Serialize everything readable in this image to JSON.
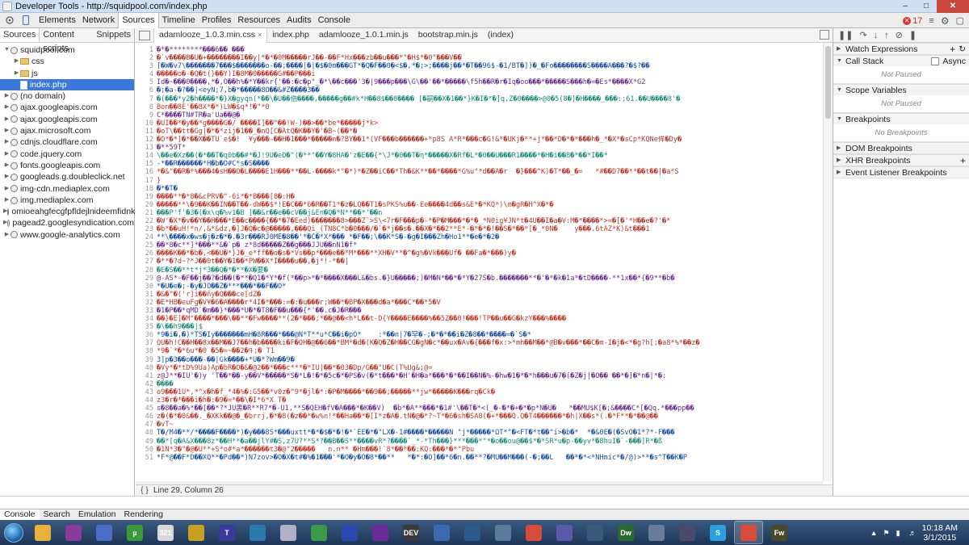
{
  "window": {
    "title": "Developer Tools - http://squidpool.com/index.php"
  },
  "toolbar": {
    "tabs": [
      "Elements",
      "Network",
      "Sources",
      "Timeline",
      "Profiles",
      "Resources",
      "Audits",
      "Console"
    ],
    "error_count": "17"
  },
  "navigator": {
    "tabs": [
      "Sources",
      "Content scripts",
      "Snippets"
    ],
    "items": [
      {
        "label": "squidpool.com",
        "type": "domain",
        "open": true,
        "indent": 0
      },
      {
        "label": "css",
        "type": "folder",
        "open": false,
        "indent": 1
      },
      {
        "label": "js",
        "type": "folder",
        "open": false,
        "indent": 1
      },
      {
        "label": "index.php",
        "type": "file",
        "open": false,
        "indent": 1,
        "selected": true
      },
      {
        "label": "(no domain)",
        "type": "domain",
        "open": false,
        "indent": 0
      },
      {
        "label": "ajax.googleapis.com",
        "type": "domain",
        "open": false,
        "indent": 0
      },
      {
        "label": "ajax.googleapis.com",
        "type": "domain",
        "open": false,
        "indent": 0
      },
      {
        "label": "ajax.microsoft.com",
        "type": "domain",
        "open": false,
        "indent": 0
      },
      {
        "label": "cdnjs.cloudflare.com",
        "type": "domain",
        "open": false,
        "indent": 0
      },
      {
        "label": "code.jquery.com",
        "type": "domain",
        "open": false,
        "indent": 0
      },
      {
        "label": "fonts.googleapis.com",
        "type": "domain",
        "open": false,
        "indent": 0
      },
      {
        "label": "googleads.g.doubleclick.net",
        "type": "domain",
        "open": false,
        "indent": 0
      },
      {
        "label": "img-cdn.mediaplex.com",
        "type": "domain",
        "open": false,
        "indent": 0
      },
      {
        "label": "img.mediaplex.com",
        "type": "domain",
        "open": false,
        "indent": 0
      },
      {
        "label": "omioeahgfecgfpfldejlnideemfidnkc",
        "type": "domain",
        "open": false,
        "indent": 0
      },
      {
        "label": "pagead2.googlesyndication.com",
        "type": "domain",
        "open": false,
        "indent": 0
      },
      {
        "label": "www.google-analytics.com",
        "type": "domain",
        "open": false,
        "indent": 0
      }
    ]
  },
  "editor": {
    "tabs": [
      "adamlooze_1.0.3.min.css",
      "index.php",
      "adamlooze_1.0.1.min.js",
      "bootstrap.min.js",
      "(index)"
    ],
    "status": "Line 29, Column 26",
    "lines": [
      "�*�********���6�� ���",
      "�`v����B�U�+��������I��y|*�*�0M�����rJ��-��F*Hx���zb��u���*\"�H$*�0\"���V��",
      "[�W�v7\\�������7���$�������o-��;����|�|�$�0m���GT*�Q�F��0�<$�,*�;>;����j��*�T��96$-�1/BT�])�_�Fo��������S����A���?�$?��",
      "�����o�-�Q�t(}��Y)I�8M�0�����G#��P���i",
      "Id�~���0����,*�,O��h%�*Y��kr{'��:�c�p\"_�*\\��c���'3�|9���p���\\G\\��'��*�����\\f5h��R�r�Iq�oo���*�����S���h�=�Es*����X*G2",
      "�;�a-�?��|<eyN;7,b�*�����8O��&#Z����3��",
      "�(���*y2�h����*�}X�gyqn(*��\\�U��俈����,�����g��#k*H��8$��8���� [�嗣��X�1��*}K�I�*�]q,Z�0����>@0�5(8�]�H����_���:;61.��U����8'�",
      "Bon��8E'��8X*�*)LW�$q*!�\"*0",
      "C*����TN#TR�a'Ua��@�",
      "�UI��*�y��*g����G�/ ����I]��\"��!W-)��>��*be*�����j*k>",
      "�oT\\��tt�Gg|�*�*zij�1��_�nQ[C�AtQ�K��Y�'�B~(��*�",
      "�O*�*]�*��X��TU`e$�!  ¥y���-��H�1���*�����n�?BY��1*(VF���b������+*p8S A*R*���c�G!&*�UKj�**+j*��*D�*�*���h�_*�X*�sCp*KQNe侔�Dy�",
      "�**59T*",
      "\\��e�Xz��(�*��T�q0b��#*�J!9U�eD�\"(�**\"��Y�8HA�'z�E��{*\\J*�0��T�η*�����X�Rf�L*�0��U���R1����*�H�i��8�*��*I��*",
      "-*��R������*H�b�O#C*s�S����",
      "*�&\"��R�*%���4�sH��O�L����E1H���**��L-����k*\"�*)*�Z��iC��*Th�&K**��*����*G%u\"*d��A�r  �}���^K)�T*��_�=   *#��D7��**��t��|�a*S",
      "}",
      "�*�T�",
      "����**�*8�&cPRV�\"-6i*�*B���[8�:H�",
      "�����**\\�9��K��IN��T��-dW��$*!E�C��*6�R��T1*�z�LQ��T1�sPKS%u��-Ee����4d��s&E*�*KQ*)\\m�gR�H^X�*�",
      "���P'f'�3�(�x\\q�%v1�B ]��&r��e��cV��j&En�Q�*N**��*'��n",
      "�W'�X*�v��Y��H���*E��c����{��*�7�Eed)�������8>���Z`>S\\<7r�F���p�-*�P�M���*�*�_*N0ig¥JN*t�4U��I�a�V:M�*����*>=�[�'*H��e�?'�*",
      "�b*��uH!*n/,&*&dz,�]J�Q�c�@�����,���Qi_(TN8C*b�0���/�`�*j��s�.��X�*��2**E*-�*�*�!��S�*��*[�_*0N�    y���.6tÁZ*K)&t���1",
      "**\\����x�ws�j�z�*�.�3r���RJ0ME�8��'*�C�*X*��� *�F��;\\��K*S�-�g�I���Zh�Ho1**�e�*�2�",
      "��*8�c**]*���**&�`p� z*8d�����Z��g���JJU��nN1�f*",
      "����K��*�b�,<��U�*}J�_e*ff��o�s�*Vs��p*���e��*M*���**XH�V**�^�g%�Vk���Uf� ��Fa�*���)y�",
      "�**�?d~?*J��0t��Y�1��*PW��X*I����u��,�j*!-*��|",
      "�E�S��**t*j*3��Q�*�**�X�要�",
      "@-AS*-�F��j��?�d��(�**�Q1�*Y*�f(*��p>*�*����X���L&�bs.�}U�����;)�M�N*��*�*Y�27S�b.�������**�'�*�k�1a*�tD����-**1x��*{�9**�b�",
      "*�Ú�e�;-�y�JO��Z�***���*��F��O*",
      "�&�\"�('r]i��ñy�Q���ce[dZ�",
      "�E*HB�euFg�V¥�6�A����r*4I�*���:=�:�u���r;W��*�BP�X���d�a*���C*��*5�V",
      "�1�P��*qMD`�m��}*���*U�*�T8�F��u���{*'��.c�J�R���",
      "��}�E[�M\"����*���\\��**�Fw����**(2�*���;*��@��<h*L��t-D{Y����E����%��5Z��0!���!TP��u��G�kzY���%����",
      "�\\��h9���|$",
      "*9�i�,�)*TS�Iy�������mH�8R���*���@N*T**u*C��i�pO*    :*��n|7�罕�-;�*�*��i�Z�8��*����=�`S�*",
      "QU�h!C��H��8x��M��J7��h�b����ki�F�OH�@��6��*BM*�d�(K�Q�Z�H��CG�gN�c*��ux�Av�{���f�x:>*mh��M��*@B�v���*��C�m-I�j�<*�g?h[;�a8*%*��z�",
      "*9�`*�*6u*�0 �5�=~��ߟ�2;� T1",
      "3]p�3��o���-��|Gk����+*U�*?Wm��9�",
      "�Vy*�*tD%9Ua)Ap�bR�O�&�@2��*���c***�*IU|��*�03�Dp/G��\"U�C(T%Ug&;@=",
      "z@J**�IU'�)y 'T��*��-y��V*�����*S�*L�!�*�5c�*�PS�v(�*t���*�H'�H�a*���*�*��I��N�%-�hw�1�*�*h���u�7�(�Z�j|�O�� ��*�]�*n�|*�:",
      "����",
      "o9���1U*,*^x�h�f_*4�%�:G5��*v0z�\"9*�jl�*:�P�M����*��9��;�����**jw*�����K���rq�Ck�",
      "z3�r�*���i�h�:�9�=*��\\�I*6*X T�",
      "s�8��a�%*��[��*?*JU黑�R**R7*�-U1,**S�QEH�fV�A���*�K��V)  �b*�A**���*�1#'\\��T�*<(_�-�*�+�*�p*N�U�   *��MU$K[�;&����C*[�Qq.*���pp��",
      "z�(�*�0&��._�XKk��@�_�brrj,�*�8(�z��*�w%n!*��Ha��*�[I*z�A�.tN�@�*?~T*�6�sh�SA8(�+*���Q.Q�T4������*�h|X��s*(.�*F**�*��@��",
      "�vT~",
      "T�/M4�**/*����F����*)�y���8S*���uxtt*�*�$�*�!�*`EE�*�\"LX�-1#����*�����N \"j*�����*ΩT*\"�<FT�*t��\"i>�b�*  *�&0E�(�SvO�1*?*-F���",
      "��*[q�A&X���8z*��H**�a��jlY#�S,z7U?**S*?��B��S**����vR*?����`_*-*Th���}***���*\"*�o��ou@��$*�*SR*u�p-��yv*�8huI�`-���]R*�ß",
      "�1N*3�\"�@�U**+S*o#*a*������t3�@\"2�����   n.n** �Hm���!`8*��*��:KQ:���*�*\"Pbu",
      "*F*@��F*D��XQ**�Pd��*)N7zov>�O�X�t#�%�1���'*�O�y�O�8*��**   *�*:�O]��*6�n.��**?�MU��M���(-�;��L   ��*�*<*NHmic*�/@)>**�s^T��K�P"
    ]
  },
  "sidebar": {
    "sections": [
      {
        "title": "Watch Expressions",
        "open": false,
        "controls": [
          "+",
          "refresh"
        ]
      },
      {
        "title": "Call Stack",
        "open": true,
        "controls": [
          "checkbox"
        ],
        "control_label": "Async",
        "body": "Not Paused"
      },
      {
        "title": "Scope Variables",
        "open": true,
        "body": "Not Paused"
      },
      {
        "title": "Breakpoints",
        "open": true,
        "body": "No Breakpoints"
      },
      {
        "title": "DOM Breakpoints",
        "open": false
      },
      {
        "title": "XHR Breakpoints",
        "open": false,
        "controls": [
          "+"
        ]
      },
      {
        "title": "Event Listener Breakpoints",
        "open": false
      }
    ]
  },
  "drawer": {
    "tabs": [
      "Console",
      "Search",
      "Emulation",
      "Rendering"
    ]
  },
  "taskbar": {
    "apps": [
      {
        "name": "explorer",
        "color": "#e8b23a",
        "label": ""
      },
      {
        "name": "app2",
        "color": "#8a3a9a",
        "label": ""
      },
      {
        "name": "app3",
        "color": "#4a6ec7",
        "label": ""
      },
      {
        "name": "utorrent",
        "color": "#3a9a3a",
        "label": "µ"
      },
      {
        "name": "calendar",
        "color": "#d8d8d8",
        "label": "321"
      },
      {
        "name": "app6",
        "color": "#c8a020",
        "label": ""
      },
      {
        "name": "app7",
        "color": "#3a3a9a",
        "label": "T"
      },
      {
        "name": "app8",
        "color": "#2a7ab0",
        "label": ""
      },
      {
        "name": "app9",
        "color": "#b0b0c8",
        "label": ""
      },
      {
        "name": "app10",
        "color": "#3a9a4a",
        "label": ""
      },
      {
        "name": "app11",
        "color": "#2a4ab0",
        "label": ""
      },
      {
        "name": "visual-studio",
        "color": "#6a2a9a",
        "label": ""
      },
      {
        "name": "app13",
        "color": "#3a3a3a",
        "label": "DEV"
      },
      {
        "name": "app14",
        "color": "#3a6ab0",
        "label": ""
      },
      {
        "name": "app15",
        "color": "#2a5a8a",
        "label": ""
      },
      {
        "name": "app16",
        "color": "#5a7a9a",
        "label": ""
      },
      {
        "name": "chrome",
        "color": "#d84a3a",
        "label": ""
      },
      {
        "name": "app18",
        "color": "#5a5aaa",
        "label": ""
      },
      {
        "name": "app19",
        "color": "#3a5a7a",
        "label": ""
      },
      {
        "name": "dreamweaver",
        "color": "#2a6a2a",
        "label": "Dw"
      },
      {
        "name": "app21",
        "color": "#6a7a9a",
        "label": ""
      },
      {
        "name": "app22",
        "color": "#4a4a6a",
        "label": ""
      },
      {
        "name": "skype",
        "color": "#2aa0e0",
        "label": "S"
      },
      {
        "name": "chrome-2",
        "color": "#d84a3a",
        "label": ""
      },
      {
        "name": "fireworks",
        "color": "#4a4a2a",
        "label": "Fw"
      }
    ],
    "time": "10:18 AM",
    "date": "3/1/2015"
  }
}
